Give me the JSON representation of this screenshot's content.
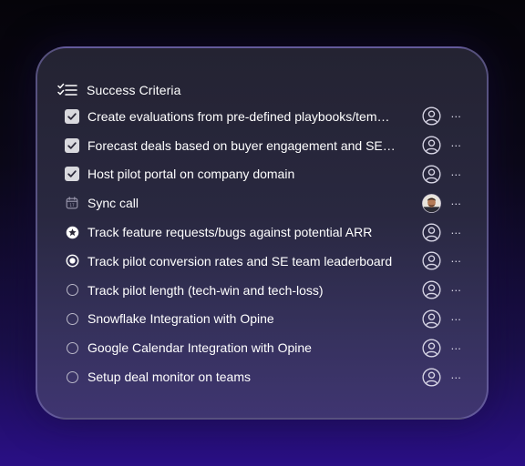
{
  "header": {
    "title": "Success Criteria",
    "icon": "checklist-icon"
  },
  "colors": {
    "checkbox_fill": "#d9d9de",
    "text": "#ffffff",
    "muted": "#b9b7c8"
  },
  "items": [
    {
      "status": "checked",
      "label": "Create evaluations from pre-defined playbooks/tem…",
      "assignee": "user-outline-icon"
    },
    {
      "status": "checked",
      "label": "Forecast deals based on buyer engagement and SE…",
      "assignee": "user-outline-icon"
    },
    {
      "status": "checked",
      "label": "Host pilot portal on company domain",
      "assignee": "user-outline-icon"
    },
    {
      "status": "calendar",
      "label": "Sync call",
      "assignee": "avatar-photo"
    },
    {
      "status": "star",
      "label": "Track feature requests/bugs against potential ARR",
      "assignee": "user-outline-icon"
    },
    {
      "status": "radio",
      "label": "Track pilot conversion rates and SE team leaderboard",
      "assignee": "user-outline-icon"
    },
    {
      "status": "empty",
      "label": "Track pilot length (tech-win and tech-loss)",
      "assignee": "user-outline-icon"
    },
    {
      "status": "empty",
      "label": "Snowflake Integration with Opine",
      "assignee": "user-outline-icon"
    },
    {
      "status": "empty",
      "label": "Google Calendar Integration with Opine",
      "assignee": "user-outline-icon"
    },
    {
      "status": "empty",
      "label": "Setup deal monitor on teams",
      "assignee": "user-outline-icon"
    }
  ],
  "more_label": "···"
}
